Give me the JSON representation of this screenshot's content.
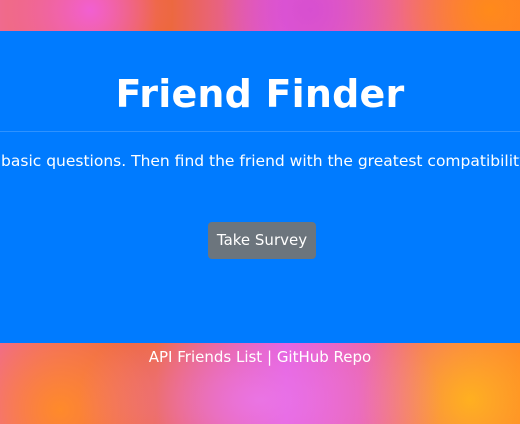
{
  "hero": {
    "title": "Friend Finder",
    "lead": "Answer a few basic questions. Then find the friend with the greatest compatibility.",
    "button_label": "Take Survey"
  },
  "footer": {
    "link_api": "API Friends List",
    "separator": "|",
    "link_repo": "GitHub Repo"
  },
  "colors": {
    "jumbotron": "#007bff",
    "button": "#6c757d",
    "text": "#ffffff"
  }
}
